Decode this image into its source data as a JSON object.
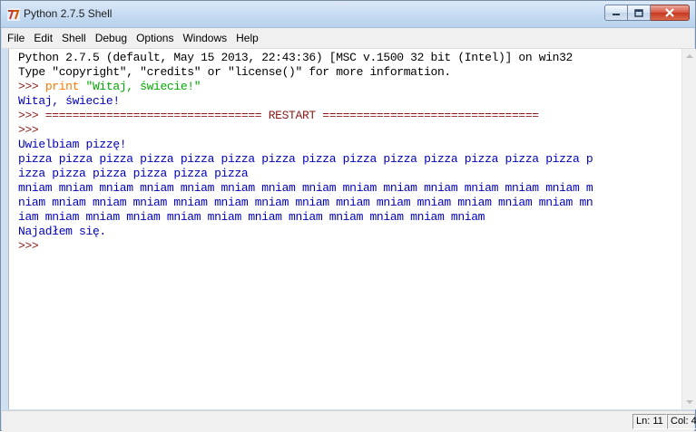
{
  "window": {
    "title": "Python 2.7.5 Shell"
  },
  "menubar": {
    "items": [
      "File",
      "Edit",
      "Shell",
      "Debug",
      "Options",
      "Windows",
      "Help"
    ]
  },
  "shell": {
    "banner_1": "Python 2.7.5 (default, May 15 2013, 22:43:36) [MSC v.1500 32 bit (Intel)] on win32",
    "banner_2": "Type \"copyright\", \"credits\" or \"license()\" for more information.",
    "prompt": ">>>",
    "command": "print \"Witaj, świecie!\"",
    "output_1": "Witaj, świecie!",
    "restart_line": ">>> ================================ RESTART ================================",
    "prompt_2": ">>>",
    "output_2": "Uwielbiam pizzę!",
    "output_3a": "pizza pizza pizza pizza pizza pizza pizza pizza pizza pizza pizza pizza pizza pizza p",
    "output_3b": "izza pizza pizza pizza pizza pizza",
    "output_4a": "mniam mniam mniam mniam mniam mniam mniam mniam mniam mniam mniam mniam mniam mniam m",
    "output_4b": "niam mniam mniam mniam mniam mniam mniam mniam mniam mniam mniam mniam mniam mniam mn",
    "output_4c": "iam mniam mniam mniam mniam mniam mniam mniam mniam mniam mniam mniam",
    "output_5": "Najadłem się.",
    "prompt_3": ">>>"
  },
  "status": {
    "line": "Ln: 11",
    "col": "Col: 4"
  },
  "colors": {
    "prompt": "#8b1a1a",
    "keyword": "#ff7700",
    "string": "#00aa00",
    "output": "#0000bb"
  }
}
